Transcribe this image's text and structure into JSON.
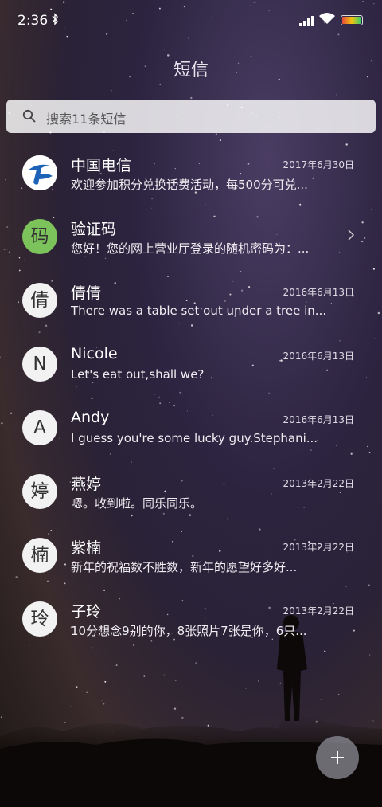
{
  "status_bar": {
    "time": "2:36",
    "bluetooth_icon": "bluetooth-icon",
    "signal_icon": "signal-icon",
    "wifi_icon": "wifi-icon",
    "battery_icon": "battery-icon"
  },
  "header": {
    "title": "短信"
  },
  "search": {
    "placeholder": "搜索11条短信",
    "icon": "search-icon"
  },
  "conversations": [
    {
      "name": "中国电信",
      "date": "2017年6月30日",
      "preview": "欢迎参加积分兑换话费活动，每500分可兑...",
      "avatar": "",
      "avatar_type": "logo"
    },
    {
      "name": "验证码",
      "date": "",
      "preview": "您好！您的网上营业厅登录的随机密码为：...",
      "avatar": "码",
      "avatar_color": "#7dc35b"
    },
    {
      "name": "倩倩",
      "date": "2016年6月13日",
      "preview": "There was a table set out under a tree in...",
      "avatar": "倩"
    },
    {
      "name": "Nicole",
      "date": "2016年6月13日",
      "preview": "Let's eat out,shall we?",
      "avatar": "N"
    },
    {
      "name": "Andy",
      "date": "2016年6月13日",
      "preview": "I guess you're some lucky guy.Stephani...",
      "avatar": "A"
    },
    {
      "name": "燕婷",
      "date": "2013年2月22日",
      "preview": "嗯。收到啦。同乐同乐。",
      "avatar": "婷"
    },
    {
      "name": "紫楠",
      "date": "2013年2月22日",
      "preview": "新年的祝福数不胜数，新年的愿望好多好...",
      "avatar": "楠"
    },
    {
      "name": "子玲",
      "date": "2013年2月22日",
      "preview": "10分想念9别的你，8张照片7张是你，6只...",
      "avatar": "玲"
    }
  ],
  "fab": {
    "icon": "plus-icon"
  }
}
